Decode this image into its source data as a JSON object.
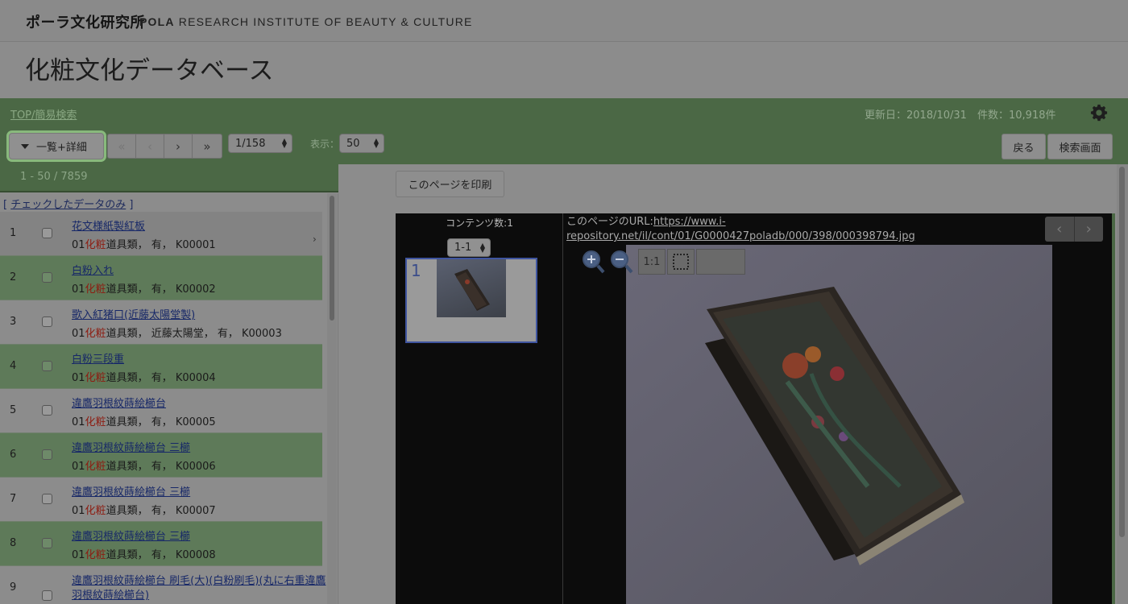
{
  "brand": {
    "jp": "ポーラ文化研究所",
    "en_bold": "POLA",
    "en_rest": " RESEARCH INSTITUTE OF BEAUTY & CULTURE"
  },
  "page_title": "化粧文化データベース",
  "breadcrumb": "TOP/簡易検索",
  "updated": "更新日：2018/10/31",
  "count": "件数：10,918件",
  "toolbar": {
    "view_mode": "一覧+詳細",
    "pager": [
      "«",
      "‹",
      "›",
      "»"
    ],
    "page_select": "1/158",
    "show_label": "表示：",
    "show_select": "50",
    "back": "戻る",
    "search_screen": "検索画面"
  },
  "results": {
    "range": "1 - 50 / 7859",
    "checked_only_open": "[ ",
    "checked_only": "チェックしたデータのみ",
    "checked_only_close": " ]",
    "rows": [
      {
        "num": "1",
        "title": "花文様紙製紅板",
        "pre": "01",
        "red": "化粧",
        "post": "道具類， 有， K00001"
      },
      {
        "num": "2",
        "title": "白粉入れ",
        "pre": "01",
        "red": "化粧",
        "post": "道具類， 有， K00002"
      },
      {
        "num": "3",
        "title": "歌入紅猪口(近藤太陽堂製)",
        "pre": "01",
        "red": "化粧",
        "post": "道具類， 近藤太陽堂， 有， K00003"
      },
      {
        "num": "4",
        "title": "白粉三段重",
        "pre": "01",
        "red": "化粧",
        "post": "道具類， 有， K00004"
      },
      {
        "num": "5",
        "title": "違鷹羽根紋蒔絵櫛台",
        "pre": "01",
        "red": "化粧",
        "post": "道具類， 有， K00005"
      },
      {
        "num": "6",
        "title": "違鷹羽根紋蒔絵櫛台 三櫛",
        "pre": "01",
        "red": "化粧",
        "post": "道具類， 有， K00006"
      },
      {
        "num": "7",
        "title": "違鷹羽根紋蒔絵櫛台 三櫛",
        "pre": "01",
        "red": "化粧",
        "post": "道具類， 有， K00007"
      },
      {
        "num": "8",
        "title": "違鷹羽根紋蒔絵櫛台 三櫛",
        "pre": "01",
        "red": "化粧",
        "post": "道具類， 有， K00008"
      },
      {
        "num": "9",
        "title": "違鷹羽根紋蒔絵櫛台 刷毛(大)(白粉刷毛)(丸に右重違鷹",
        "title2": "羽根紋蒔絵櫛台)"
      }
    ]
  },
  "detail": {
    "print_button": "このページを印刷",
    "content_count": "コンテンツ数:1",
    "content_select": "1-1",
    "thumb_number": "1",
    "url_label": "このページのURL:",
    "url": "https://www.i-repository.net/il/cont/01/G0000427poladb/000/398/000398794.jpg",
    "url_line1": "https://www.i-",
    "url_line2": "repository.net/il/cont/01/G0000427poladb/000/398/000398794.jpg",
    "zoom_reset": "1:1",
    "nav_prev": "‹",
    "nav_next": "›"
  },
  "colors": {
    "green": "#4b6845",
    "accent_ring": "#88b97c",
    "link": "#172868",
    "highlight_red": "#8d1c11"
  }
}
